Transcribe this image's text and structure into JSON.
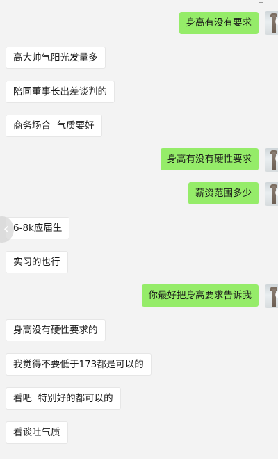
{
  "chat": {
    "messages": [
      {
        "side": "out",
        "text": "身高有没有要求"
      },
      {
        "side": "in",
        "text": "高大帅气阳光发量多"
      },
      {
        "side": "in",
        "text": "陪同董事长出差谈判的"
      },
      {
        "side": "in",
        "text": "商务场合  气质要好"
      },
      {
        "side": "out",
        "text": "身高有没有硬性要求"
      },
      {
        "side": "out",
        "text": "薪资范围多少"
      },
      {
        "side": "in",
        "text": "6-8k应届生"
      },
      {
        "side": "in",
        "text": "实习的也行"
      },
      {
        "side": "out",
        "text": "你最好把身高要求告诉我"
      },
      {
        "side": "in",
        "text": "身高没有硬性要求的"
      },
      {
        "side": "in",
        "text": "我觉得不要低于173都是可以的"
      },
      {
        "side": "in",
        "text": "看吧  特别好的都可以的"
      },
      {
        "side": "in",
        "text": "看谈吐气质"
      }
    ]
  },
  "nav": {
    "back_icon": "chevron-left-icon"
  },
  "colors": {
    "background": "#f3f3f3",
    "outgoing_bubble": "#95ec69",
    "incoming_bubble": "#ffffff"
  }
}
